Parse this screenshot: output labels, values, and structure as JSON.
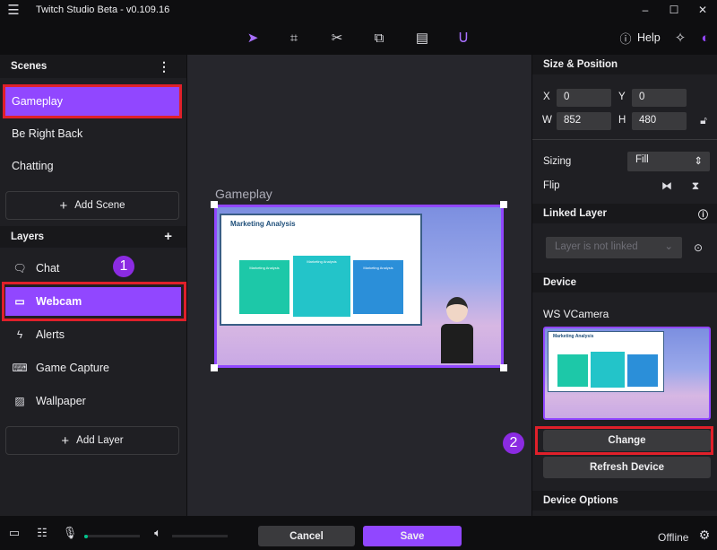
{
  "app": {
    "title": "Twitch Studio Beta - v0.109.16",
    "help": "Help"
  },
  "colors": {
    "accent": "#9147ff",
    "annotation": "#e0202a",
    "badge": "#8b2be2"
  },
  "scenes": {
    "header": "Scenes",
    "items": [
      {
        "label": "Gameplay",
        "selected": true
      },
      {
        "label": "Be Right Back"
      },
      {
        "label": "Chatting"
      }
    ],
    "add": "Add Scene"
  },
  "layers": {
    "header": "Layers",
    "items": [
      {
        "label": "Chat",
        "icon": "chat-icon"
      },
      {
        "label": "Webcam",
        "icon": "camera-icon",
        "selected": true
      },
      {
        "label": "Alerts",
        "icon": "alerts-icon"
      },
      {
        "label": "Game Capture",
        "icon": "gamepad-icon"
      },
      {
        "label": "Wallpaper",
        "icon": "image-icon"
      }
    ],
    "add": "Add Layer"
  },
  "canvas": {
    "scene_label": "Gameplay",
    "preview": {
      "title": "Marketing Analysis",
      "cards": [
        "Marketing Analysis",
        "Marketing Analysis",
        "Marketing Analysis"
      ]
    }
  },
  "annotations": {
    "one": "1",
    "two": "2"
  },
  "size_position": {
    "header": "Size & Position",
    "x_label": "X",
    "x": "0",
    "y_label": "Y",
    "y": "0",
    "w_label": "W",
    "w": "852",
    "h_label": "H",
    "h": "480"
  },
  "sizing": {
    "label": "Sizing",
    "value": "Fill"
  },
  "flip": {
    "label": "Flip"
  },
  "linked_layer": {
    "header": "Linked Layer",
    "placeholder": "Layer is not linked"
  },
  "device": {
    "header": "Device",
    "name": "WS VCamera",
    "change": "Change",
    "refresh": "Refresh Device",
    "preview_title": "Marketing Analysis"
  },
  "device_options": {
    "header": "Device Options"
  },
  "footer": {
    "cancel": "Cancel",
    "save": "Save",
    "status": "Offline",
    "mic_level": 0.05
  }
}
